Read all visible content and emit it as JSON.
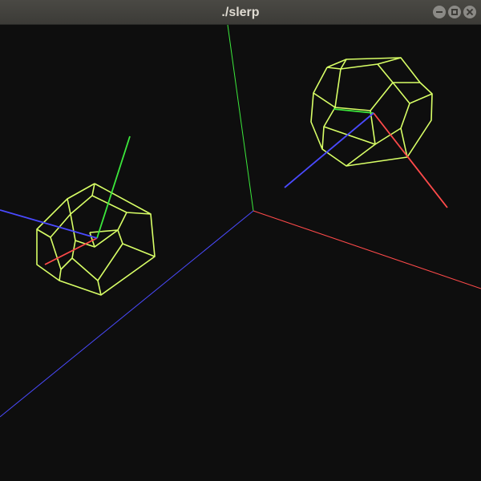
{
  "window": {
    "title": "./slerp"
  },
  "colors": {
    "background": "#0e0e0e",
    "wireframe": "#d8ff66",
    "axis_x": "#ff4a4a",
    "axis_y": "#3ce83c",
    "axis_z": "#4a4aff"
  },
  "scene": {
    "objects": [
      "world-axes",
      "dodecahedron-left",
      "dodecahedron-right"
    ]
  }
}
